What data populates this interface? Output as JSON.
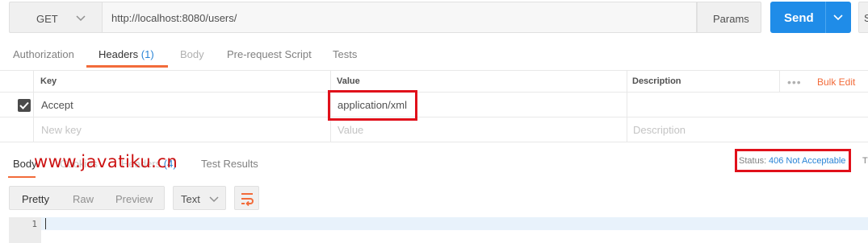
{
  "request": {
    "method": "GET",
    "url": "http://localhost:8080/users/",
    "params_label": "Params",
    "send_label": "Send",
    "save_stub": "S"
  },
  "request_tabs": [
    {
      "label": "Authorization",
      "count": "",
      "state": "normal"
    },
    {
      "label": "Headers",
      "count": "(1)",
      "state": "active"
    },
    {
      "label": "Body",
      "count": "",
      "state": "disabled"
    },
    {
      "label": "Pre-request Script",
      "count": "",
      "state": "normal"
    },
    {
      "label": "Tests",
      "count": "",
      "state": "normal"
    }
  ],
  "headers_table": {
    "columns": [
      "Key",
      "Value",
      "Description"
    ],
    "more_icon": "ellipsis-icon",
    "bulk_edit_label": "Bulk Edit",
    "rows": [
      {
        "checked": true,
        "key": "Accept",
        "value": "application/xml",
        "description": ""
      }
    ],
    "placeholders": {
      "key": "New key",
      "value": "Value",
      "description": "Description"
    }
  },
  "response_tabs": [
    {
      "label": "Body",
      "count": ""
    },
    {
      "label": "Cookies",
      "count": ""
    },
    {
      "label": "Headers",
      "count": "(4)"
    },
    {
      "label": "Test Results",
      "count": ""
    }
  ],
  "response_status": {
    "label": "Status:",
    "value": "406 Not Acceptable",
    "time_stub": "Ti"
  },
  "watermark": "www.javatiku.cn",
  "response_toolbar": {
    "view_modes": [
      "Pretty",
      "Raw",
      "Preview"
    ],
    "active_view": "Pretty",
    "format": "Text",
    "wrap_icon": "wrap-lines-icon"
  },
  "editor": {
    "line_numbers": [
      "1"
    ]
  },
  "colors": {
    "accent_blue": "#1f8ce8",
    "tab_underline": "#f26b3a",
    "highlight_box": "#e0101a",
    "status_blue": "#2a84d6"
  }
}
